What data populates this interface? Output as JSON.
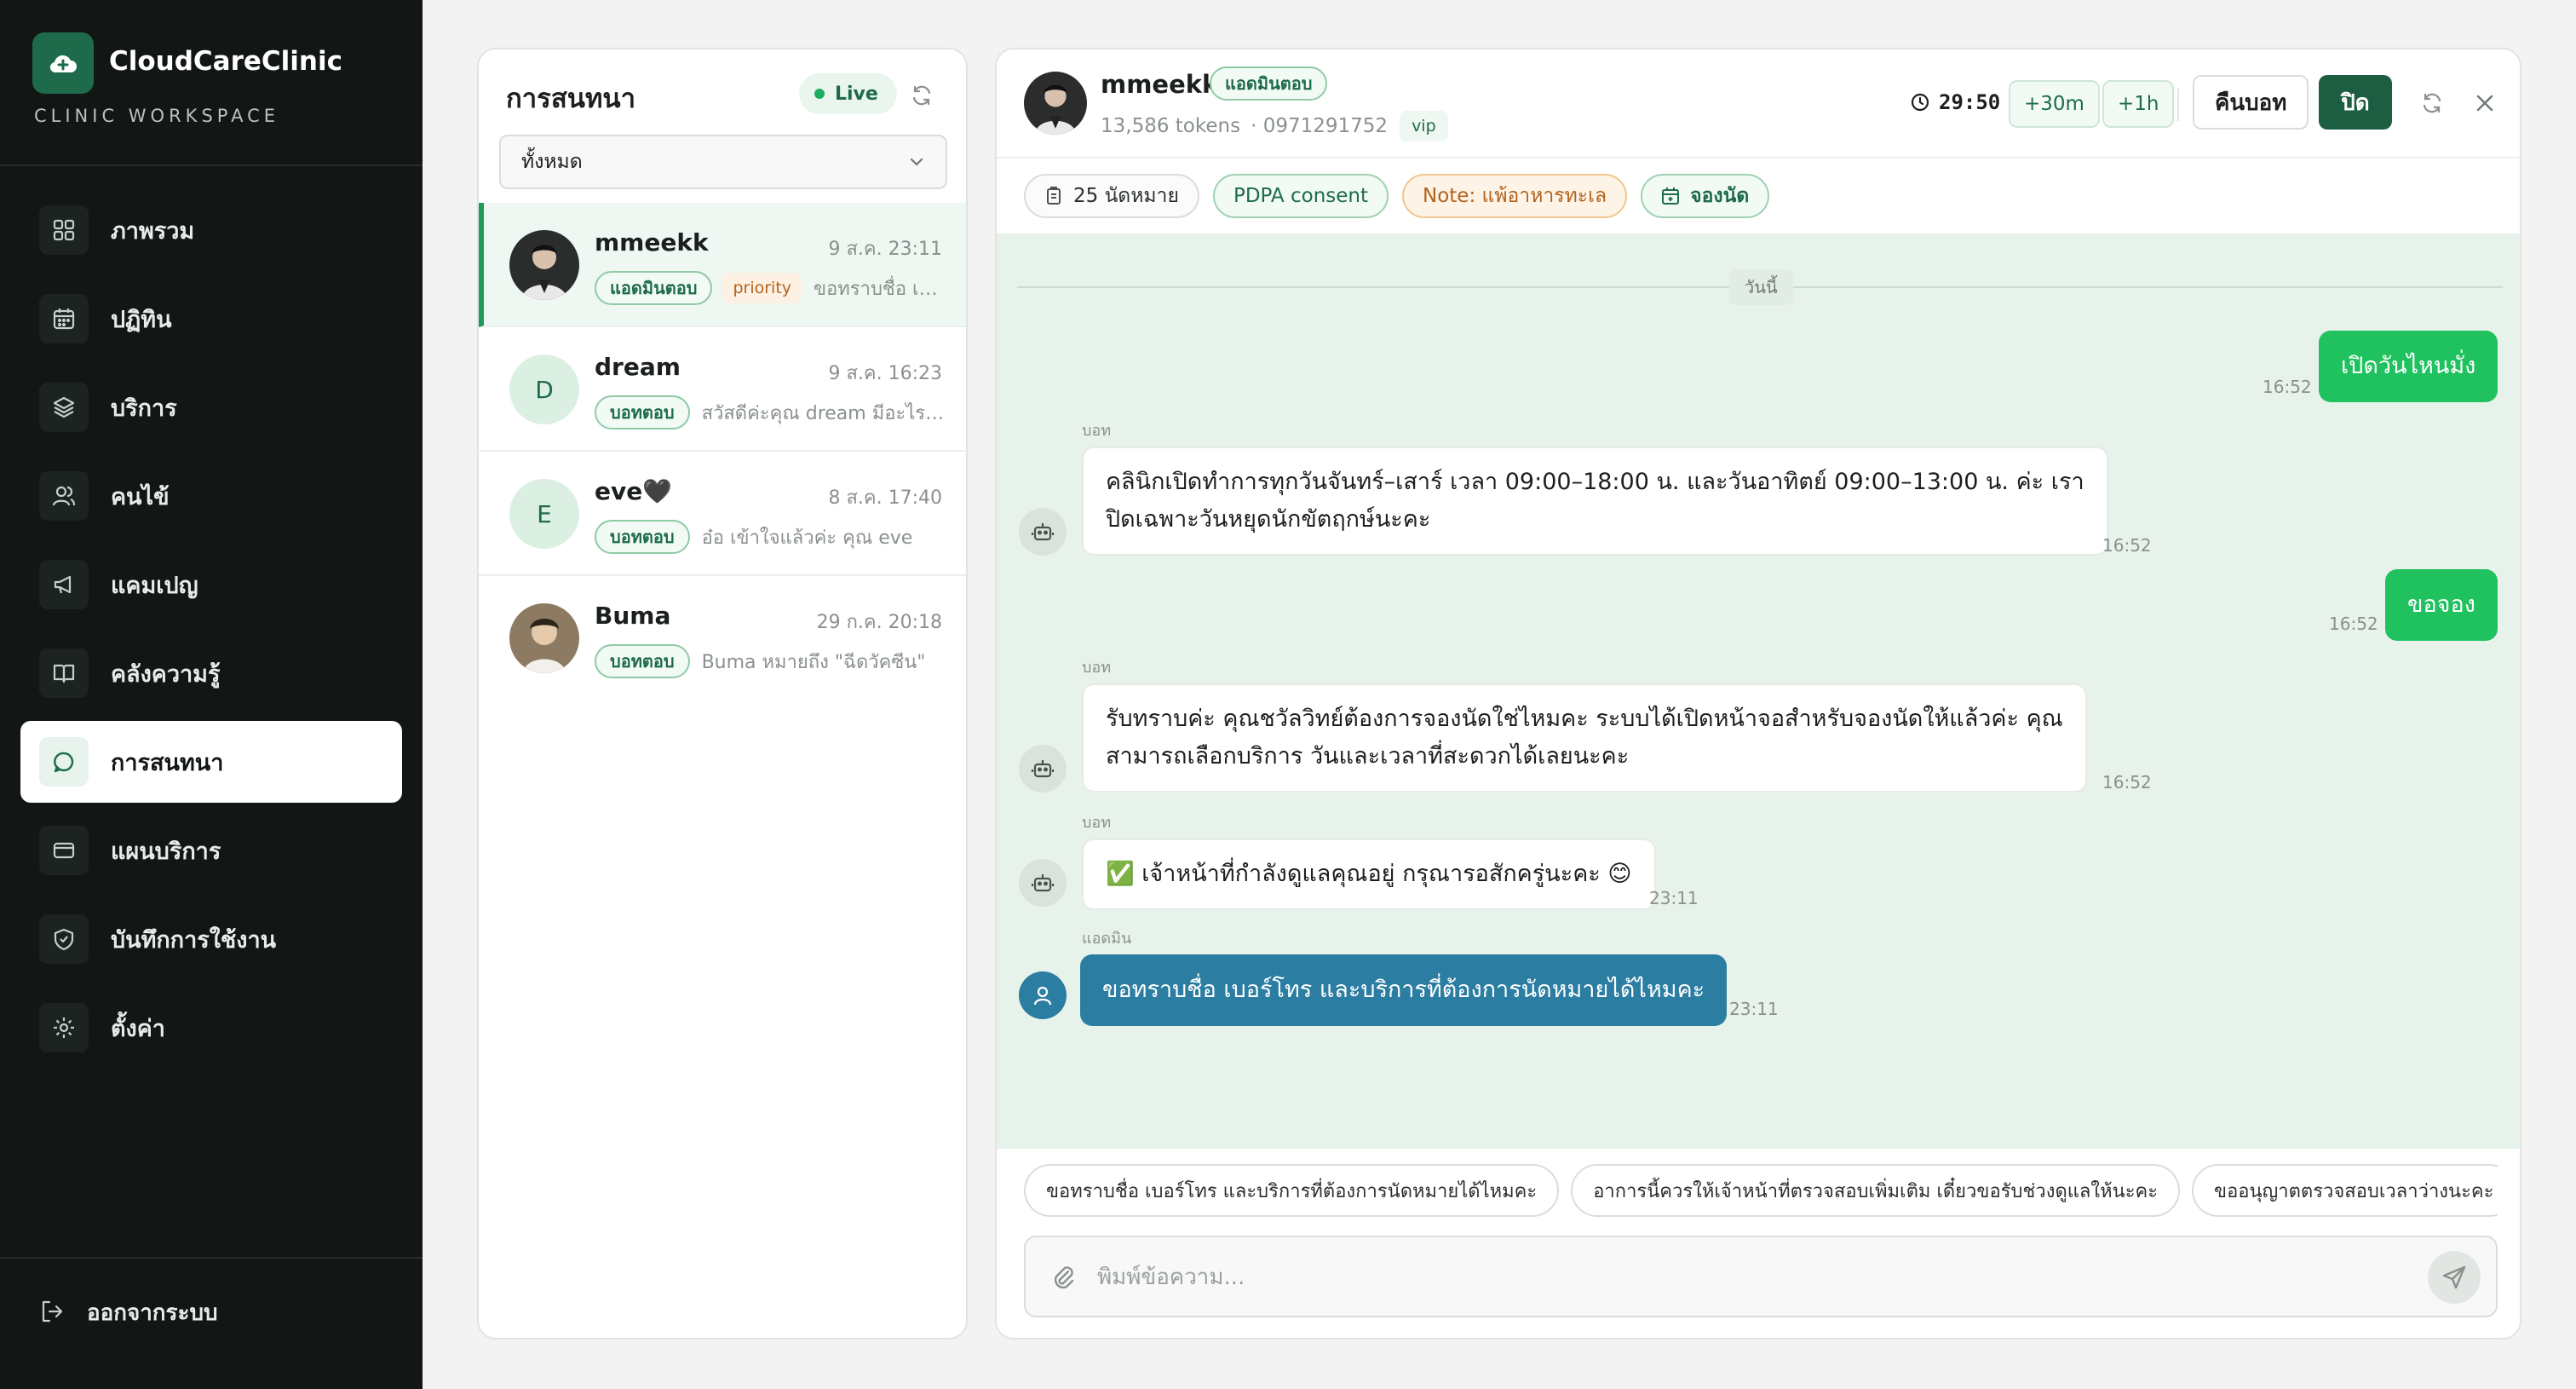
{
  "app": {
    "name": "CloudCareClinic",
    "subtitle": "CLINIC WORKSPACE"
  },
  "sidebar": {
    "items": [
      {
        "label": "ภาพรวม",
        "icon": "grid-icon"
      },
      {
        "label": "ปฏิทิน",
        "icon": "calendar-icon"
      },
      {
        "label": "บริการ",
        "icon": "layers-icon"
      },
      {
        "label": "คนไข้",
        "icon": "users-icon"
      },
      {
        "label": "แคมเปญ",
        "icon": "megaphone-icon"
      },
      {
        "label": "คลังความรู้",
        "icon": "book-icon"
      },
      {
        "label": "การสนทนา",
        "icon": "chat-icon",
        "active": true
      },
      {
        "label": "แผนบริการ",
        "icon": "card-icon"
      },
      {
        "label": "บันทึกการใช้งาน",
        "icon": "shield-icon"
      },
      {
        "label": "ตั้งค่า",
        "icon": "gear-icon"
      }
    ],
    "logout_label": "ออกจากระบบ"
  },
  "conversation_list": {
    "title": "การสนทนา",
    "live_label": "Live",
    "filter_value": "ทั้งหมด",
    "items": [
      {
        "name": "mmeekk",
        "time": "9 ส.ค. 23:11",
        "badge": "แอดมินตอบ",
        "priority": "priority",
        "preview": "ขอทราบชื่อ เบอร์โทร และบริการที่ต้องการ"
      },
      {
        "name": "dream",
        "initial": "D",
        "time": "9 ส.ค. 16:23",
        "badge": "บอทตอบ",
        "preview": "สวัสดีค่ะคุณ dream มีอะไรให้ช่วยคะ"
      },
      {
        "name": "eve🖤",
        "initial": "E",
        "time": "8 ส.ค. 17:40",
        "badge": "บอทตอบ",
        "preview": "อ๋อ เข้าใจแล้วค่ะ คุณ eve"
      },
      {
        "name": "Buma",
        "time": "29 ก.ค. 20:18",
        "badge": "บอทตอบ",
        "preview": "Buma หมายถึง \"ฉีดวัคซีน\""
      }
    ]
  },
  "chat": {
    "name": "mmeekk",
    "mode_badge": "แอดมินตอบ",
    "tokens": "13,586 tokens",
    "phone": "· 0971291752",
    "tag": "vip",
    "timer": "29:50",
    "extend_30": "+30m",
    "extend_60": "+1h",
    "return_label": "คืนบอท",
    "close_label": "ปิด",
    "chips": {
      "appointments": "25 นัดหมาย",
      "consent": "PDPA consent",
      "note": "Note: แพ้อาหารทะเล",
      "book": "จองนัด"
    },
    "date_label": "วันนี้",
    "messages": [
      {
        "role": "user",
        "text": "เปิดวันไหนมั่ง",
        "time": "16:52"
      },
      {
        "role": "bot",
        "sender": "บอท",
        "lines": [
          "คลินิกเปิดทำการทุกวันจันทร์–เสาร์ เวลา 09:00–18:00 น. และวันอาทิตย์ 09:00–13:00 น. ค่ะ เรา",
          "ปิดเฉพาะวันหยุดนักขัตฤกษ์นะคะ"
        ],
        "time": "16:52"
      },
      {
        "role": "user",
        "text": "ขอจอง",
        "time": "16:52"
      },
      {
        "role": "bot",
        "sender": "บอท",
        "lines": [
          "รับทราบค่ะ คุณชวัลวิทย์ต้องการจองนัดใช่ไหมคะ ระบบได้เปิดหน้าจอสำหรับจองนัดให้แล้วค่ะ คุณ",
          "สามารถเลือกบริการ วันและเวลาที่สะดวกได้เลยนะคะ"
        ],
        "time": "16:52"
      },
      {
        "role": "bot",
        "sender": "บอท",
        "lines": [
          "✅ เจ้าหน้าที่กำลังดูแลคุณอยู่ กรุณารอสักครู่นะคะ 😊"
        ],
        "time": "23:11"
      },
      {
        "role": "admin",
        "sender": "แอดมิน",
        "text": "ขอทราบชื่อ เบอร์โทร และบริการที่ต้องการนัดหมายได้ไหมคะ",
        "time": "23:11"
      }
    ],
    "quick_replies": [
      "ขอทราบชื่อ เบอร์โทร และบริการที่ต้องการนัดหมายได้ไหมคะ",
      "อาการนี้ควรให้เจ้าหน้าที่ตรวจสอบเพิ่มเติม เดี๋ยวขอรับช่วงดูแลให้นะคะ",
      "ขออนุญาตตรวจสอบเวลาว่างนะคะ"
    ],
    "composer_placeholder": "พิมพ์ข้อความ..."
  }
}
